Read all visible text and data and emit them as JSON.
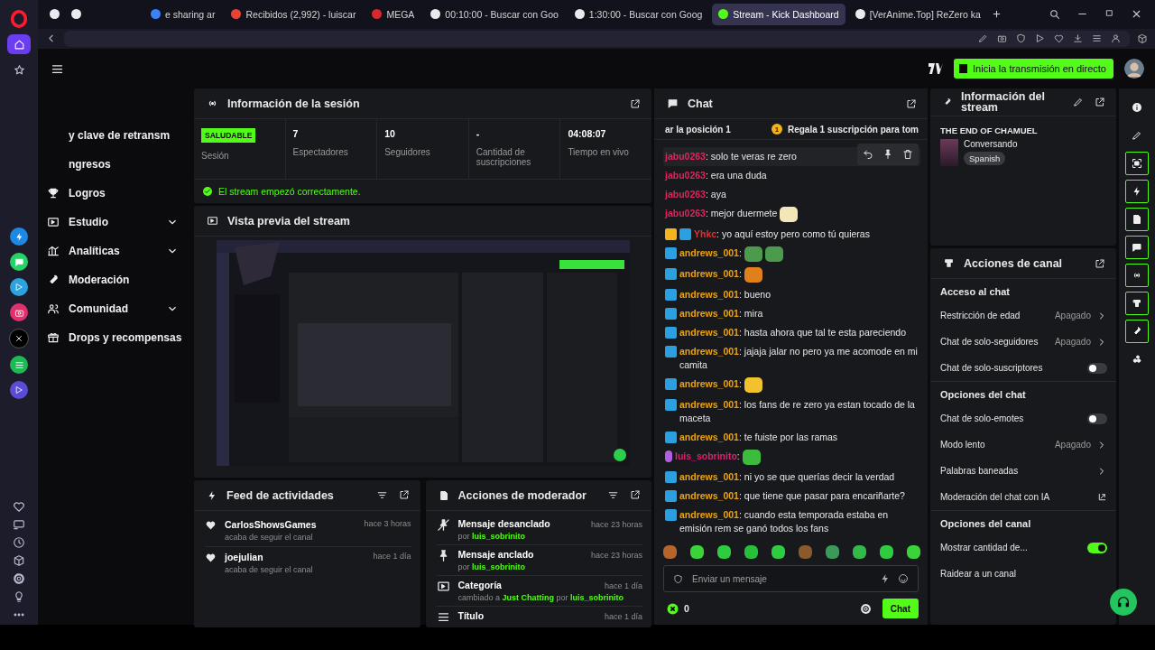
{
  "browser": {
    "sidebar": [
      {
        "selected": true
      },
      {
        "selected": false
      }
    ],
    "tabs": [
      {
        "title": "e sharing ar",
        "selected": false,
        "color": "#3b82f6"
      },
      {
        "title": "Recibidos (2,992) - luiscar",
        "selected": false,
        "color": "#ea4335"
      },
      {
        "title": "MEGA",
        "selected": false,
        "color": "#d9272e"
      },
      {
        "title": "00:10:00 - Buscar con Goo",
        "selected": false,
        "color": "#e8eaed"
      },
      {
        "title": "1:30:00 - Buscar con Goog",
        "selected": false,
        "color": "#e8eaed"
      },
      {
        "title": "Stream - Kick Dashboard",
        "selected": true,
        "color": "#53fc18"
      },
      {
        "title": "[VerAnime.Top] ReZero ka",
        "selected": false,
        "color": "#e8eaed"
      }
    ]
  },
  "topbar": {
    "go_live": "Inicia la transmisión en directo"
  },
  "nav": {
    "items": [
      {
        "label": "y clave de retransm",
        "submenu": false
      },
      {
        "label": "ngresos",
        "submenu": false
      },
      {
        "label": "Logros",
        "submenu": false
      },
      {
        "label": "Estudio",
        "submenu": true
      },
      {
        "label": "Analíticas",
        "submenu": true
      },
      {
        "label": "Moderación",
        "submenu": false
      },
      {
        "label": "Comunidad",
        "submenu": true
      },
      {
        "label": "Drops y recompensas",
        "submenu": false
      }
    ]
  },
  "session": {
    "title": "Información de la sesión",
    "status": "SALUDABLE",
    "status_label": "Sesión",
    "stats": [
      {
        "value": "7",
        "label": "Espectadores"
      },
      {
        "value": "10",
        "label": "Seguidores"
      },
      {
        "value": "-",
        "label": "Cantidad de suscripciones"
      },
      {
        "value": "04:08:07",
        "label": "Tiempo en vivo"
      }
    ],
    "message": "El stream empezó correctamente."
  },
  "preview": {
    "title": "Vista previa del stream",
    "kind": "picture"
  },
  "activity": {
    "title": "Feed de actividades",
    "items": [
      {
        "name": "CarlosShowsGames",
        "action": "acaba de seguir el canal",
        "time": "hace 3 horas"
      },
      {
        "name": "joejulian",
        "action": "acaba de seguir el canal",
        "time": "hace 1 día"
      }
    ]
  },
  "mod_actions": {
    "title": "Acciones de moderador",
    "items": [
      {
        "kind": "unpin",
        "title": "Mensaje desanclado",
        "time": "hace 23 horas",
        "detail": [
          {
            "text": "por "
          },
          {
            "text": "luis_sobrinito",
            "link": true
          }
        ]
      },
      {
        "kind": "pin",
        "title": "Mensaje anclado",
        "time": "hace 23 horas",
        "detail": [
          {
            "text": "por "
          },
          {
            "text": "luis_sobrinito",
            "link": true
          }
        ]
      },
      {
        "kind": "category",
        "title": "Categoría",
        "time": "hace 1 día",
        "detail": [
          {
            "text": "cambiado a "
          },
          {
            "text": "Just Chatting",
            "link": true
          },
          {
            "text": " por "
          },
          {
            "text": "luis_sobrinito",
            "link": true
          }
        ]
      },
      {
        "kind": "title",
        "title": "Título",
        "time": "hace 1 día"
      }
    ]
  },
  "chat": {
    "title": "Chat",
    "pinned_left": "ar la posición 1",
    "pinned_badge": "1",
    "pinned_right": "Regala 1 suscripción para tom",
    "messages": [
      {
        "user": "jabu0263",
        "color": "#e0245e",
        "text": ": solo te veras re zero",
        "hovered": true
      },
      {
        "user": "jabu0263",
        "color": "#e0245e",
        "text": ": era una duda",
        "hovered": false
      },
      {
        "user": "jabu0263",
        "color": "#e0245e",
        "text": ": aya",
        "hovered": false
      },
      {
        "user": "jabu0263",
        "color": "#e0245e",
        "text": ": mejor duermete",
        "emotes": [
          {
            "color": "#f3e6b8"
          }
        ],
        "hovered": false
      },
      {
        "user": "Yhkc",
        "color": "#e5302e",
        "badges": [
          {
            "kind": "vip"
          },
          {
            "kind": "moderator"
          }
        ],
        "text": ": yo aquí estoy pero como tú quieras",
        "hovered": false
      },
      {
        "user": "andrews_001",
        "color": "#e8a317",
        "badges": [
          {
            "kind": "moderator"
          }
        ],
        "text": ":",
        "emotes": [
          {
            "color": "#4c9a4c"
          },
          {
            "color": "#4c9a4c"
          }
        ],
        "hovered": false
      },
      {
        "user": "andrews_001",
        "color": "#e8a317",
        "badges": [
          {
            "kind": "moderator"
          }
        ],
        "text": ":",
        "emotes": [
          {
            "color": "#e0801c"
          }
        ],
        "hovered": false
      },
      {
        "user": "andrews_001",
        "color": "#e8a317",
        "badges": [
          {
            "kind": "moderator"
          }
        ],
        "text": ": bueno",
        "hovered": false
      },
      {
        "user": "andrews_001",
        "color": "#e8a317",
        "badges": [
          {
            "kind": "moderator"
          }
        ],
        "text": ": mira",
        "hovered": false
      },
      {
        "user": "andrews_001",
        "color": "#e8a317",
        "badges": [
          {
            "kind": "moderator"
          }
        ],
        "text": ": hasta ahora que tal te esta pareciendo",
        "hovered": false
      },
      {
        "user": "andrews_001",
        "color": "#e8a317",
        "badges": [
          {
            "kind": "moderator"
          }
        ],
        "text": ": jajaja jalar no pero ya me acomode en mi camita",
        "hovered": false
      },
      {
        "user": "andrews_001",
        "color": "#e8a317",
        "badges": [
          {
            "kind": "moderator"
          }
        ],
        "text": ":",
        "emotes": [
          {
            "color": "#f2c12e"
          }
        ],
        "hovered": false
      },
      {
        "user": "andrews_001",
        "color": "#e8a317",
        "badges": [
          {
            "kind": "moderator"
          }
        ],
        "text": ": los fans de re zero ya estan tocado de la maceta",
        "hovered": false
      },
      {
        "user": "andrews_001",
        "color": "#e8a317",
        "badges": [
          {
            "kind": "moderator"
          }
        ],
        "text": ": te fuiste por las ramas",
        "hovered": false
      },
      {
        "user": "luis_sobrinito",
        "color": "#d6246e",
        "badges": [
          {
            "kind": "broadcaster"
          }
        ],
        "text": ":",
        "emotes": [
          {
            "color": "#3dbb3d"
          }
        ],
        "hovered": false
      },
      {
        "user": "andrews_001",
        "color": "#e8a317",
        "badges": [
          {
            "kind": "moderator"
          }
        ],
        "text": ": ni yo se que querías decir la verdad",
        "hovered": false
      },
      {
        "user": "andrews_001",
        "color": "#e8a317",
        "badges": [
          {
            "kind": "moderator"
          }
        ],
        "text": ": que tiene que pasar para encariñarte?",
        "hovered": false
      },
      {
        "user": "andrews_001",
        "color": "#e8a317",
        "badges": [
          {
            "kind": "moderator"
          }
        ],
        "text": ": cuando esta temporada estaba en emisión rem se ganó todos los fans",
        "hovered": false
      }
    ],
    "emote_bar": [
      {
        "color": "#b5652b"
      },
      {
        "color": "#3ad43a"
      },
      {
        "color": "#2ecc40"
      },
      {
        "color": "#27c03a"
      },
      {
        "color": "#2ecc40"
      },
      {
        "color": "#8b5a2b"
      },
      {
        "color": "#3a9a5a"
      },
      {
        "color": "#33b84a"
      },
      {
        "color": "#2ecc40"
      },
      {
        "color": "#3ad43a"
      }
    ],
    "placeholder": "Enviar un mensaje",
    "points": "0",
    "send": "Chat"
  },
  "stream_info": {
    "title": "Información del stream",
    "stream_title": "THE END OF CHAMUEL",
    "category": "Conversando",
    "tag": "Spanish"
  },
  "channel_actions": {
    "title": "Acciones de canal",
    "sections": [
      {
        "title": "Acceso al chat",
        "rows": [
          {
            "label": "Restricción de edad",
            "kind": "select",
            "value": "Apagado"
          },
          {
            "label": "Chat de solo-seguidores",
            "kind": "select",
            "value": "Apagado"
          },
          {
            "label": "Chat de solo-suscriptores",
            "kind": "toggle",
            "on": false
          }
        ]
      },
      {
        "title": "Opciones del chat",
        "rows": [
          {
            "label": "Chat de solo-emotes",
            "kind": "toggle",
            "on": false
          },
          {
            "label": "Modo lento",
            "kind": "select",
            "value": "Apagado"
          },
          {
            "label": "Palabras baneadas",
            "kind": "link"
          },
          {
            "label": "Moderación del chat con IA",
            "kind": "external"
          }
        ]
      },
      {
        "title": "Opciones del canal",
        "rows": [
          {
            "label": "Mostrar cantidad de...",
            "kind": "toggle",
            "on": true
          },
          {
            "label": "Raidear a un canal",
            "kind": "plain"
          }
        ]
      }
    ]
  },
  "rail": [
    {
      "active": false
    },
    {
      "active": false
    },
    {
      "active": true
    },
    {
      "active": true
    },
    {
      "active": true
    },
    {
      "active": true
    },
    {
      "active": true
    },
    {
      "active": true
    },
    {
      "active": true
    },
    {
      "active": false
    }
  ]
}
